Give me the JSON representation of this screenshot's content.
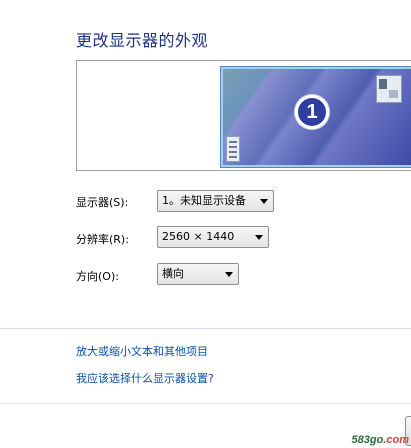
{
  "page": {
    "title": "更改显示器的外观"
  },
  "monitor_preview": {
    "monitor_number": "1"
  },
  "settings": {
    "display": {
      "label": "显示器(S):",
      "value": "1。未知显示设备"
    },
    "resolution": {
      "label": "分辨率(R):",
      "value": "2560 × 1440"
    },
    "orientation": {
      "label": "方向(O):",
      "value": "横向"
    }
  },
  "links": {
    "text_size": "放大或缩小文本和其他项目",
    "which_settings": "我应该选择什么显示器设置?"
  },
  "watermark": {
    "site": "583go.",
    "tld": "com"
  }
}
